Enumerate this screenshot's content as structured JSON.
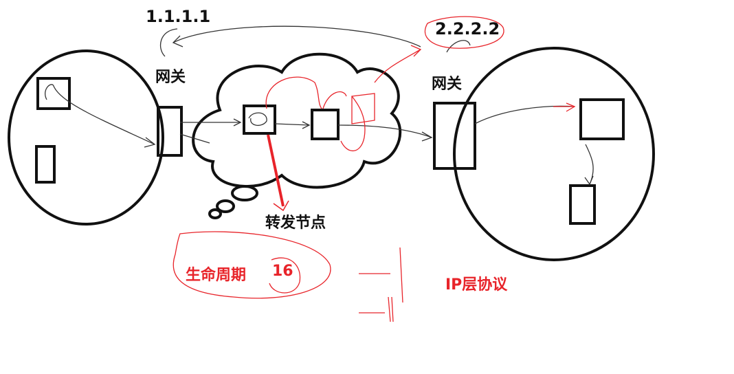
{
  "labels": {
    "ip_left": "1.1.1.1",
    "ip_right": "2.2.2.2",
    "gateway_left": "网关",
    "gateway_right": "网关",
    "forward_node": "转发节点",
    "ttl_label": "生命周期",
    "ttl_value": "16",
    "ip_protocol": "IP层协议"
  },
  "colors": {
    "ink": "#111111",
    "sketch": "#333333",
    "annotation": "#e8242a"
  }
}
